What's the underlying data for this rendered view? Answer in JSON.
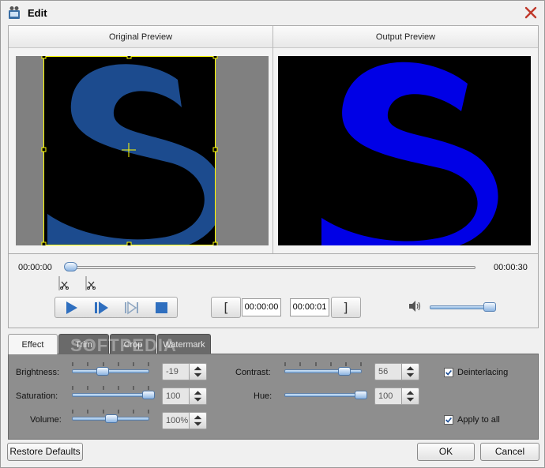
{
  "window": {
    "title": "Edit"
  },
  "preview": {
    "original_label": "Original Preview",
    "output_label": "Output Preview"
  },
  "playback": {
    "current_time": "00:00:00",
    "total_time": "00:00:30",
    "seek_position": 0.0,
    "start_time": "00:00:00",
    "end_time": "00:00:01",
    "volume": 0.9
  },
  "tabs": [
    {
      "label": "Effect",
      "active": true
    },
    {
      "label": "Trim",
      "active": false
    },
    {
      "label": "Crop",
      "active": false
    },
    {
      "label": "Watermark",
      "active": false
    }
  ],
  "effect": {
    "brightness": {
      "label": "Brightness:",
      "value": "-19"
    },
    "saturation": {
      "label": "Saturation:",
      "value": "100"
    },
    "volume": {
      "label": "Volume:",
      "value": "100%"
    },
    "contrast": {
      "label": "Contrast:",
      "value": "56"
    },
    "hue": {
      "label": "Hue:",
      "value": "100"
    },
    "deinterlacing": {
      "label": "Deinterlacing",
      "checked": true
    },
    "apply_to_all": {
      "label": "Apply to all",
      "checked": true
    }
  },
  "buttons": {
    "restore_defaults": "Restore Defaults",
    "ok": "OK",
    "cancel": "Cancel"
  },
  "watermark_text": "SOFTPEDIA",
  "colors": {
    "original_logo": "#1d4f96",
    "output_logo": "#0000e6",
    "tab_panel": "#8e8e8e",
    "crop_frame": "#ffff00",
    "slider_accent": "#86b2de"
  }
}
